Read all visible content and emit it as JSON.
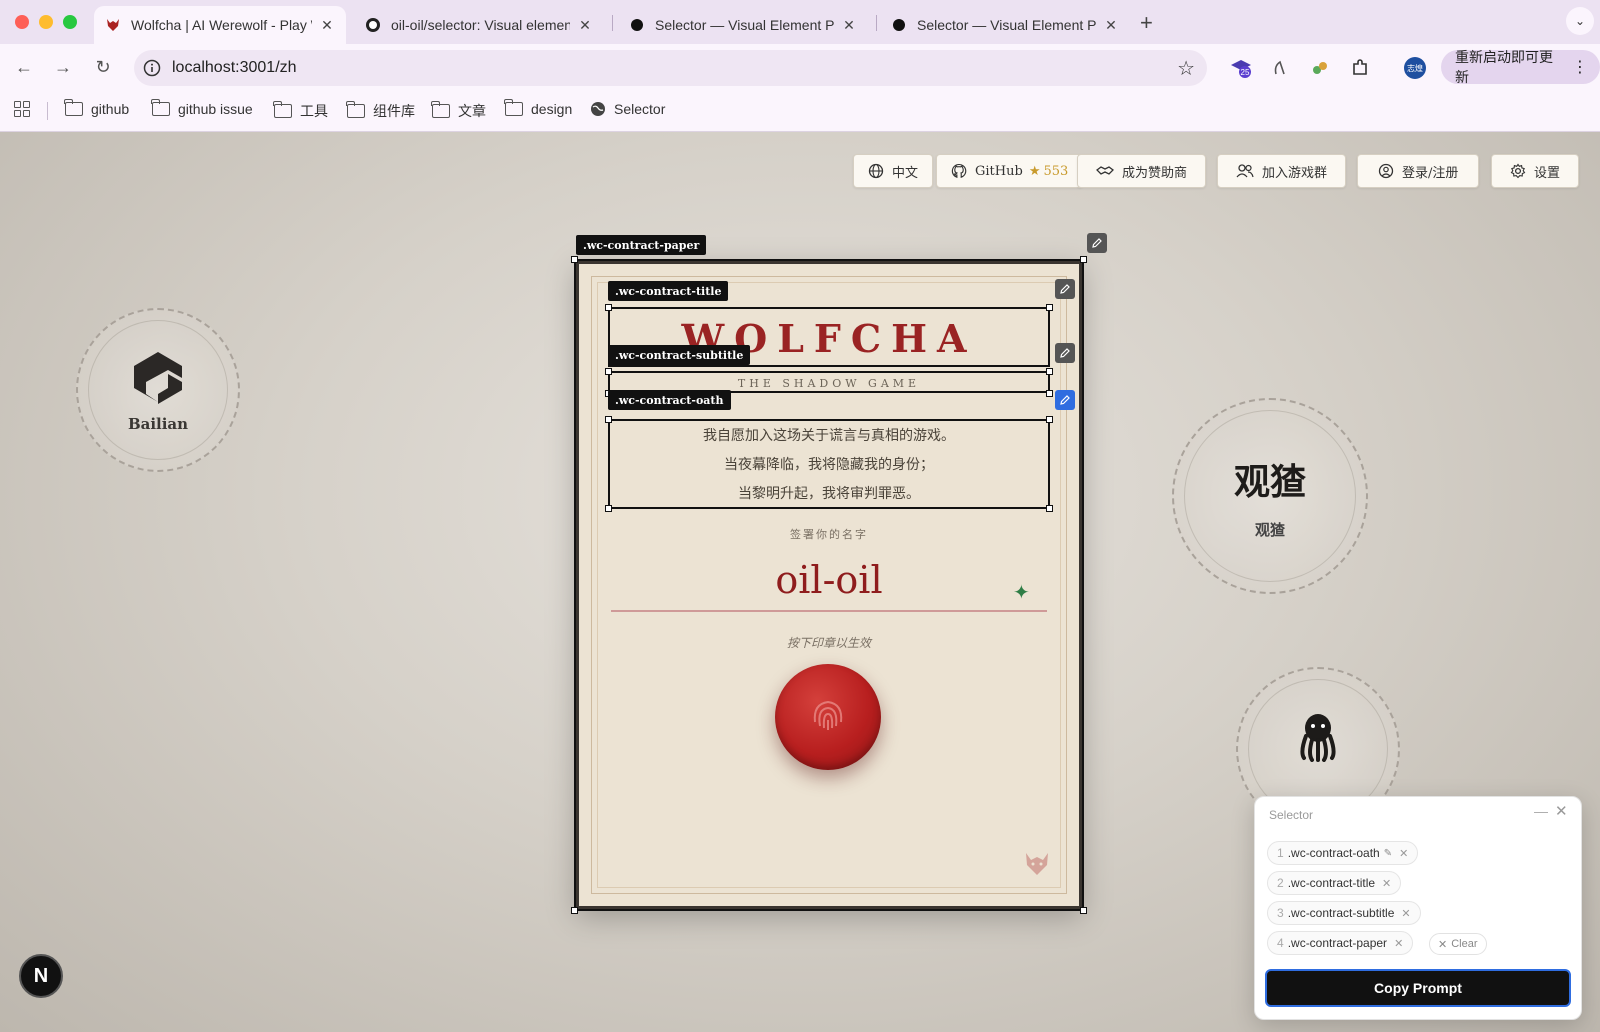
{
  "browser": {
    "tabs": [
      {
        "title": "Wolfcha | AI Werewolf - Play With AI",
        "active": true
      },
      {
        "title": "oil-oil/selector: Visual element picker",
        "active": false
      },
      {
        "title": "Selector — Visual Element Picker",
        "active": false
      },
      {
        "title": "Selector — Visual Element Picker",
        "active": false
      }
    ],
    "url": "localhost:3001/zh",
    "update_button": "重新启动即可更新",
    "extension_badge": "25",
    "profile_chip": "志煌",
    "bookmarks": [
      "github",
      "github issue",
      "工具",
      "组件库",
      "文章",
      "design",
      "Selector"
    ]
  },
  "page": {
    "top_buttons": {
      "language": "中文",
      "github": "GitHub",
      "github_stars": "553",
      "sponsor": "成为赞助商",
      "join_group": "加入游戏群",
      "login": "登录/注册",
      "settings": "设置"
    },
    "brands": {
      "left": "Bailian",
      "right_logo": "观猹",
      "right_label": "观猹"
    },
    "contract": {
      "title": "WOLFCHA",
      "subtitle": "THE SHADOW GAME",
      "oath": [
        "我自愿加入这场关于谎言与真相的游戏。",
        "当夜幕降临，我将隐藏我的身份；",
        "当黎明升起，我将审判罪恶。"
      ],
      "sign_label": "签署你的名字",
      "name": "oil-oil",
      "press_hint": "按下印章以生效"
    },
    "overlay_tags": {
      "paper": ".wc-contract-paper",
      "title": ".wc-contract-title",
      "subtitle": ".wc-contract-subtitle",
      "oath": ".wc-contract-oath"
    }
  },
  "selector_panel": {
    "title": "Selector",
    "items": [
      {
        "index": "1",
        "selector": ".wc-contract-oath"
      },
      {
        "index": "2",
        "selector": ".wc-contract-title"
      },
      {
        "index": "3",
        "selector": ".wc-contract-subtitle"
      },
      {
        "index": "4",
        "selector": ".wc-contract-paper"
      }
    ],
    "clear_label": "Clear",
    "copy_label": "Copy Prompt"
  },
  "n_badge": "N"
}
